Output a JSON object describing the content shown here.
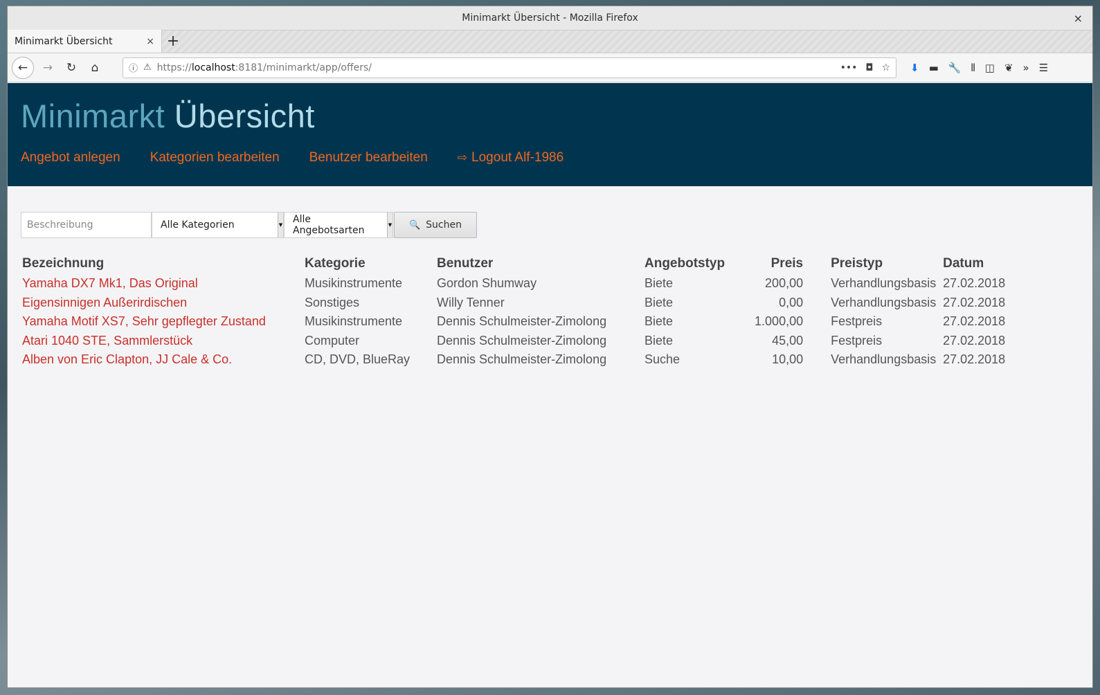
{
  "window": {
    "title": "Minimarkt Übersicht - Mozilla Firefox",
    "close_glyph": "×"
  },
  "tab": {
    "label": "Minimarkt Übersicht",
    "close_glyph": "×",
    "new_tab_glyph": "+"
  },
  "url": {
    "scheme": "https://",
    "host": "localhost",
    "rest": ":8181/minimarkt/app/offers/"
  },
  "site": {
    "brand_first": "Minimarkt",
    "brand_second": "Übersicht",
    "nav": {
      "create_offer": "Angebot anlegen",
      "edit_categories": "Kategorien bearbeiten",
      "edit_users": "Benutzer bearbeiten",
      "logout": "Logout Alf-1986"
    }
  },
  "search": {
    "placeholder": "Beschreibung",
    "category_select": "Alle Kategorien",
    "offer_type_select": "Alle Angebotsarten",
    "button": "Suchen"
  },
  "table": {
    "headers": {
      "title": "Bezeichnung",
      "category": "Kategorie",
      "user": "Benutzer",
      "offer_type": "Angebotstyp",
      "price": "Preis",
      "price_type": "Preistyp",
      "date": "Datum"
    },
    "rows": [
      {
        "title": "Yamaha DX7 Mk1, Das Original",
        "category": "Musikinstrumente",
        "user": "Gordon Shumway",
        "offer_type": "Biete",
        "price": "200,00",
        "price_type": "Verhandlungsbasis",
        "date": "27.02.2018"
      },
      {
        "title": "Eigensinnigen Außerirdischen",
        "category": "Sonstiges",
        "user": "Willy Tenner",
        "offer_type": "Biete",
        "price": "0,00",
        "price_type": "Verhandlungsbasis",
        "date": "27.02.2018"
      },
      {
        "title": "Yamaha Motif XS7, Sehr gepflegter Zustand",
        "category": "Musikinstrumente",
        "user": "Dennis Schulmeister-Zimolong",
        "offer_type": "Biete",
        "price": "1.000,00",
        "price_type": "Festpreis",
        "date": "27.02.2018"
      },
      {
        "title": "Atari 1040 STE, Sammlerstück",
        "category": "Computer",
        "user": "Dennis Schulmeister-Zimolong",
        "offer_type": "Biete",
        "price": "45,00",
        "price_type": "Festpreis",
        "date": "27.02.2018"
      },
      {
        "title": "Alben von Eric Clapton, JJ Cale & Co.",
        "category": "CD, DVD, BlueRay",
        "user": "Dennis Schulmeister-Zimolong",
        "offer_type": "Suche",
        "price": "10,00",
        "price_type": "Verhandlungsbasis",
        "date": "27.02.2018"
      }
    ]
  }
}
